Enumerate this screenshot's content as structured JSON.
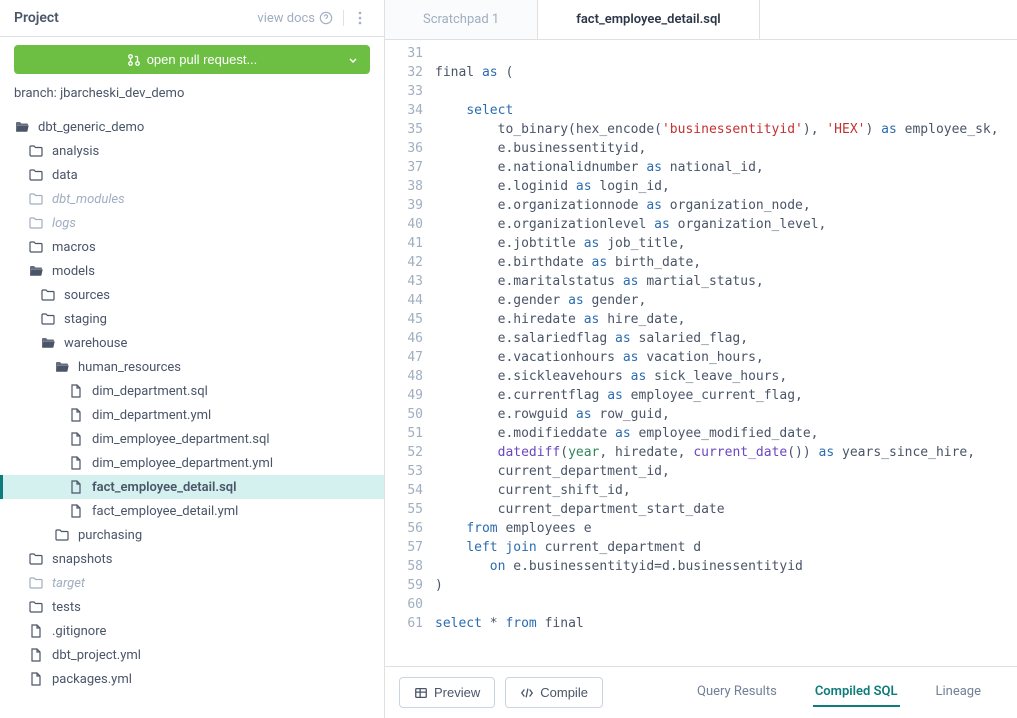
{
  "sidebar": {
    "title": "Project",
    "view_docs": "view docs",
    "pr_button": "open pull request...",
    "branch_label": "branch:",
    "branch_name": "jbarcheski_dev_demo"
  },
  "tree": [
    {
      "l": 0,
      "t": "folder-open",
      "name": "dbt_generic_demo"
    },
    {
      "l": 1,
      "t": "folder",
      "name": "analysis"
    },
    {
      "l": 1,
      "t": "folder",
      "name": "data"
    },
    {
      "l": 1,
      "t": "folder",
      "name": "dbt_modules",
      "muted": true
    },
    {
      "l": 1,
      "t": "folder",
      "name": "logs",
      "muted": true
    },
    {
      "l": 1,
      "t": "folder",
      "name": "macros"
    },
    {
      "l": 1,
      "t": "folder-open",
      "name": "models"
    },
    {
      "l": 2,
      "t": "folder",
      "name": "sources"
    },
    {
      "l": 2,
      "t": "folder",
      "name": "staging"
    },
    {
      "l": 2,
      "t": "folder-open",
      "name": "warehouse"
    },
    {
      "l": 3,
      "t": "folder-open",
      "name": "human_resources"
    },
    {
      "l": 4,
      "t": "file",
      "name": "dim_department.sql"
    },
    {
      "l": 4,
      "t": "file",
      "name": "dim_department.yml"
    },
    {
      "l": 4,
      "t": "file",
      "name": "dim_employee_department.sql"
    },
    {
      "l": 4,
      "t": "file",
      "name": "dim_employee_department.yml"
    },
    {
      "l": 4,
      "t": "file",
      "name": "fact_employee_detail.sql",
      "active": true
    },
    {
      "l": 4,
      "t": "file",
      "name": "fact_employee_detail.yml"
    },
    {
      "l": 3,
      "t": "folder",
      "name": "purchasing"
    },
    {
      "l": 1,
      "t": "folder",
      "name": "snapshots"
    },
    {
      "l": 1,
      "t": "folder",
      "name": "target",
      "muted": true
    },
    {
      "l": 1,
      "t": "folder",
      "name": "tests"
    },
    {
      "l": 1,
      "t": "file",
      "name": ".gitignore"
    },
    {
      "l": 1,
      "t": "file",
      "name": "dbt_project.yml"
    },
    {
      "l": 1,
      "t": "file",
      "name": "packages.yml"
    }
  ],
  "tabs": [
    {
      "label": "Scratchpad 1",
      "active": false
    },
    {
      "label": "fact_employee_detail.sql",
      "active": true
    }
  ],
  "code_start": 31,
  "code": [
    [
      {
        "t": ""
      }
    ],
    [
      {
        "t": "final ",
        "c": ""
      },
      {
        "t": "as",
        "c": "kw"
      },
      {
        "t": " (",
        "c": ""
      }
    ],
    [
      {
        "t": ""
      }
    ],
    [
      {
        "t": "    "
      },
      {
        "t": "select",
        "c": "kw"
      }
    ],
    [
      {
        "t": "        to_binary(hex_encode("
      },
      {
        "t": "'businessentityid'",
        "c": "str"
      },
      {
        "t": "), "
      },
      {
        "t": "'HEX'",
        "c": "str"
      },
      {
        "t": ") "
      },
      {
        "t": "as",
        "c": "kw"
      },
      {
        "t": " employee_sk,"
      }
    ],
    [
      {
        "t": "        e.businessentityid,"
      }
    ],
    [
      {
        "t": "        e.nationalidnumber "
      },
      {
        "t": "as",
        "c": "kw"
      },
      {
        "t": " national_id,"
      }
    ],
    [
      {
        "t": "        e.loginid "
      },
      {
        "t": "as",
        "c": "kw"
      },
      {
        "t": " login_id,"
      }
    ],
    [
      {
        "t": "        e.organizationnode "
      },
      {
        "t": "as",
        "c": "kw"
      },
      {
        "t": " organization_node,"
      }
    ],
    [
      {
        "t": "        e.organizationlevel "
      },
      {
        "t": "as",
        "c": "kw"
      },
      {
        "t": " organization_level,"
      }
    ],
    [
      {
        "t": "        e.jobtitle "
      },
      {
        "t": "as",
        "c": "kw"
      },
      {
        "t": " job_title,"
      }
    ],
    [
      {
        "t": "        e.birthdate "
      },
      {
        "t": "as",
        "c": "kw"
      },
      {
        "t": " birth_date,"
      }
    ],
    [
      {
        "t": "        e.maritalstatus "
      },
      {
        "t": "as",
        "c": "kw"
      },
      {
        "t": " martial_status,"
      }
    ],
    [
      {
        "t": "        e.gender "
      },
      {
        "t": "as",
        "c": "kw"
      },
      {
        "t": " gender,"
      }
    ],
    [
      {
        "t": "        e.hiredate "
      },
      {
        "t": "as",
        "c": "kw"
      },
      {
        "t": " hire_date,"
      }
    ],
    [
      {
        "t": "        e.salariedflag "
      },
      {
        "t": "as",
        "c": "kw"
      },
      {
        "t": " salaried_flag,"
      }
    ],
    [
      {
        "t": "        e.vacationhours "
      },
      {
        "t": "as",
        "c": "kw"
      },
      {
        "t": " vacation_hours,"
      }
    ],
    [
      {
        "t": "        e.sickleavehours "
      },
      {
        "t": "as",
        "c": "kw"
      },
      {
        "t": " sick_leave_hours,"
      }
    ],
    [
      {
        "t": "        e.currentflag "
      },
      {
        "t": "as",
        "c": "kw"
      },
      {
        "t": " employee_current_flag,"
      }
    ],
    [
      {
        "t": "        e.rowguid "
      },
      {
        "t": "as",
        "c": "kw"
      },
      {
        "t": " row_guid,"
      }
    ],
    [
      {
        "t": "        e.modifieddate "
      },
      {
        "t": "as",
        "c": "kw"
      },
      {
        "t": " employee_modified_date,"
      }
    ],
    [
      {
        "t": "        "
      },
      {
        "t": "datediff",
        "c": "fn"
      },
      {
        "t": "("
      },
      {
        "t": "year",
        "c": "fn2"
      },
      {
        "t": ", hiredate, "
      },
      {
        "t": "current_date",
        "c": "fn"
      },
      {
        "t": "()) "
      },
      {
        "t": "as",
        "c": "kw"
      },
      {
        "t": " years_since_hire,"
      }
    ],
    [
      {
        "t": "        current_department_id,"
      }
    ],
    [
      {
        "t": "        current_shift_id,"
      }
    ],
    [
      {
        "t": "        current_department_start_date"
      }
    ],
    [
      {
        "t": "    "
      },
      {
        "t": "from",
        "c": "kw"
      },
      {
        "t": " employees e"
      }
    ],
    [
      {
        "t": "    "
      },
      {
        "t": "left",
        "c": "kw"
      },
      {
        "t": " "
      },
      {
        "t": "join",
        "c": "kw"
      },
      {
        "t": " current_department d"
      }
    ],
    [
      {
        "t": "       "
      },
      {
        "t": "on",
        "c": "kw"
      },
      {
        "t": " e.businessentityid=d.businessentityid"
      }
    ],
    [
      {
        "t": ")"
      }
    ],
    [
      {
        "t": ""
      }
    ],
    [
      {
        "t": ""
      },
      {
        "t": "select",
        "c": "kw"
      },
      {
        "t": " * "
      },
      {
        "t": "from",
        "c": "kw"
      },
      {
        "t": " final"
      }
    ]
  ],
  "footer": {
    "preview": "Preview",
    "compile": "Compile",
    "tabs": [
      {
        "label": "Query Results",
        "active": false
      },
      {
        "label": "Compiled SQL",
        "active": true
      },
      {
        "label": "Lineage",
        "active": false
      }
    ]
  }
}
